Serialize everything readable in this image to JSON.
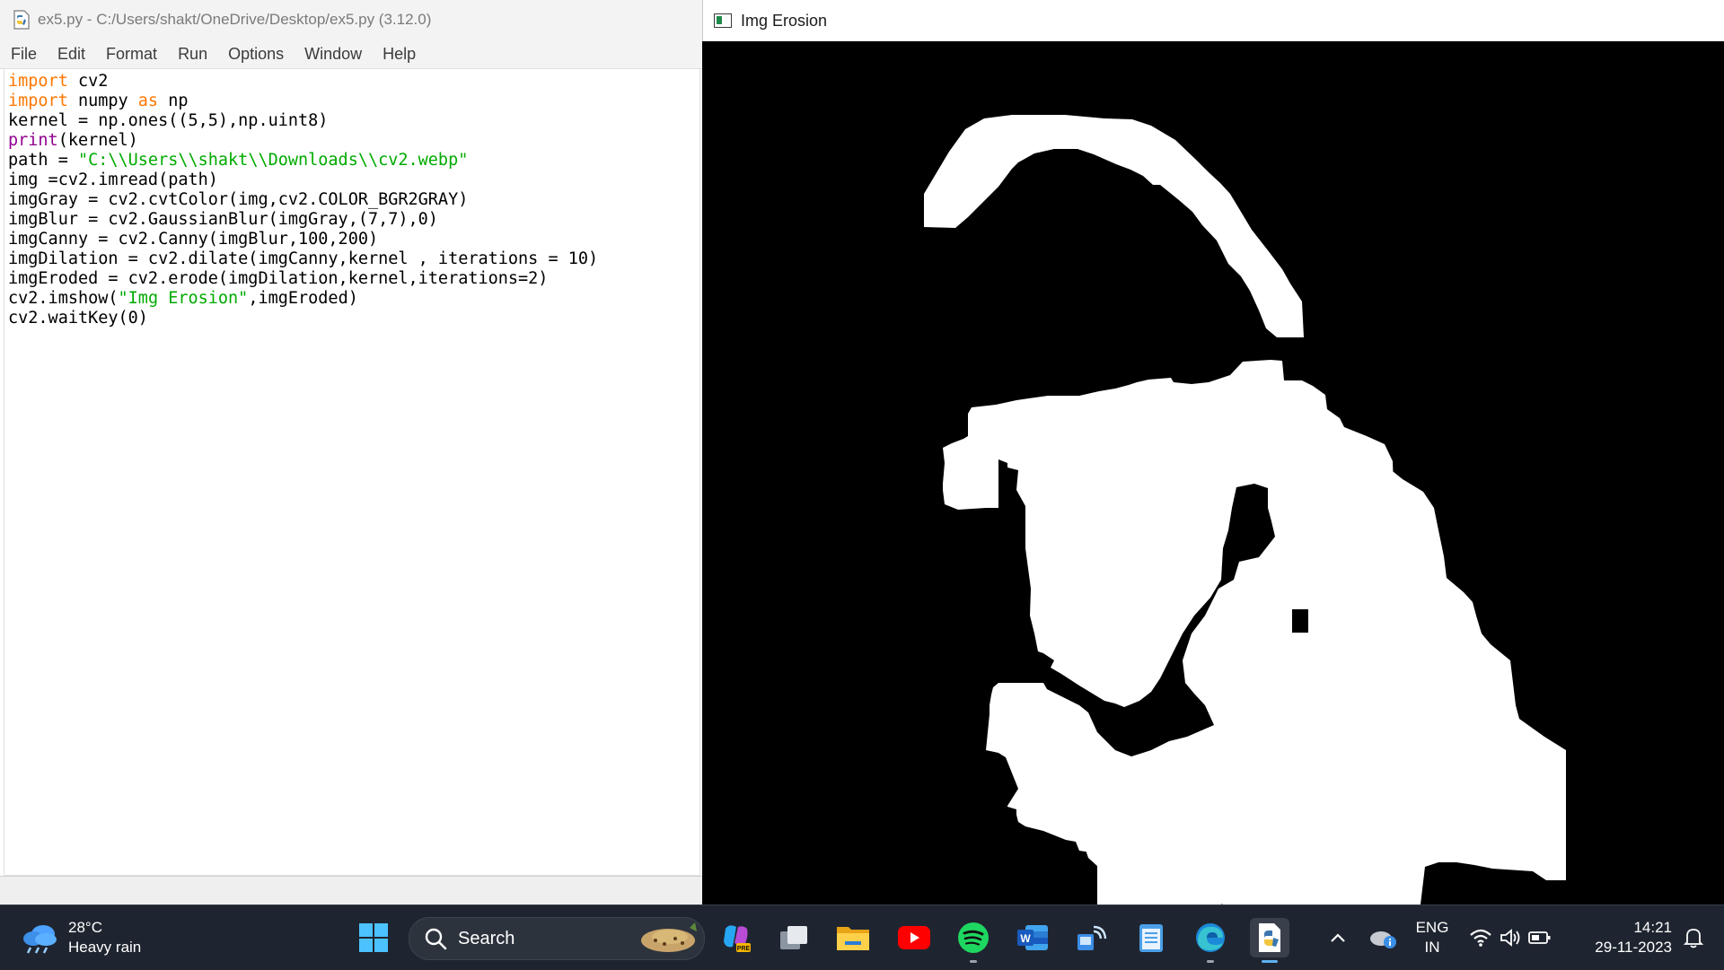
{
  "editor": {
    "title": "ex5.py - C:/Users/shakt/OneDrive/Desktop/ex5.py (3.12.0)",
    "menu": [
      "File",
      "Edit",
      "Format",
      "Run",
      "Options",
      "Window",
      "Help"
    ],
    "code_lines": [
      "import cv2",
      "import numpy as np",
      "kernel = np.ones((5,5),np.uint8)",
      "print(kernel)",
      "path = \"C:\\\\Users\\\\shakt\\\\Downloads\\\\cv2.webp\"",
      "img =cv2.imread(path)",
      "imgGray = cv2.cvtColor(img,cv2.COLOR_BGR2GRAY)",
      "imgBlur = cv2.GaussianBlur(imgGray,(7,7),0)",
      "imgCanny = cv2.Canny(imgBlur,100,200)",
      "imgDilation = cv2.dilate(imgCanny,kernel , iterations = 10)",
      "imgEroded = cv2.erode(imgDilation,kernel,iterations=2)",
      "cv2.imshow(\"Img Erosion\",imgEroded)",
      "cv2.waitKey(0)"
    ],
    "syntax_colors": {
      "keyword": "#ff7700",
      "builtin": "#900090",
      "string": "#00aa00"
    }
  },
  "image_window": {
    "title": "Img Erosion",
    "background": "#000000",
    "foreground": "#ffffff"
  },
  "taskbar": {
    "weather": {
      "temp": "28°C",
      "condition": "Heavy rain"
    },
    "search_label": "Search",
    "apps": [
      "windows-start",
      "search",
      "copilot",
      "task-view",
      "file-explorer",
      "youtube",
      "spotify",
      "word",
      "connect",
      "notepad",
      "edge",
      "python-idle"
    ],
    "tray": {
      "lang_top": "ENG",
      "lang_bottom": "IN",
      "time": "14:21",
      "date": "29-11-2023"
    },
    "colors": {
      "background": "#1f2530",
      "active_indicator": "#5fb2f2"
    }
  }
}
